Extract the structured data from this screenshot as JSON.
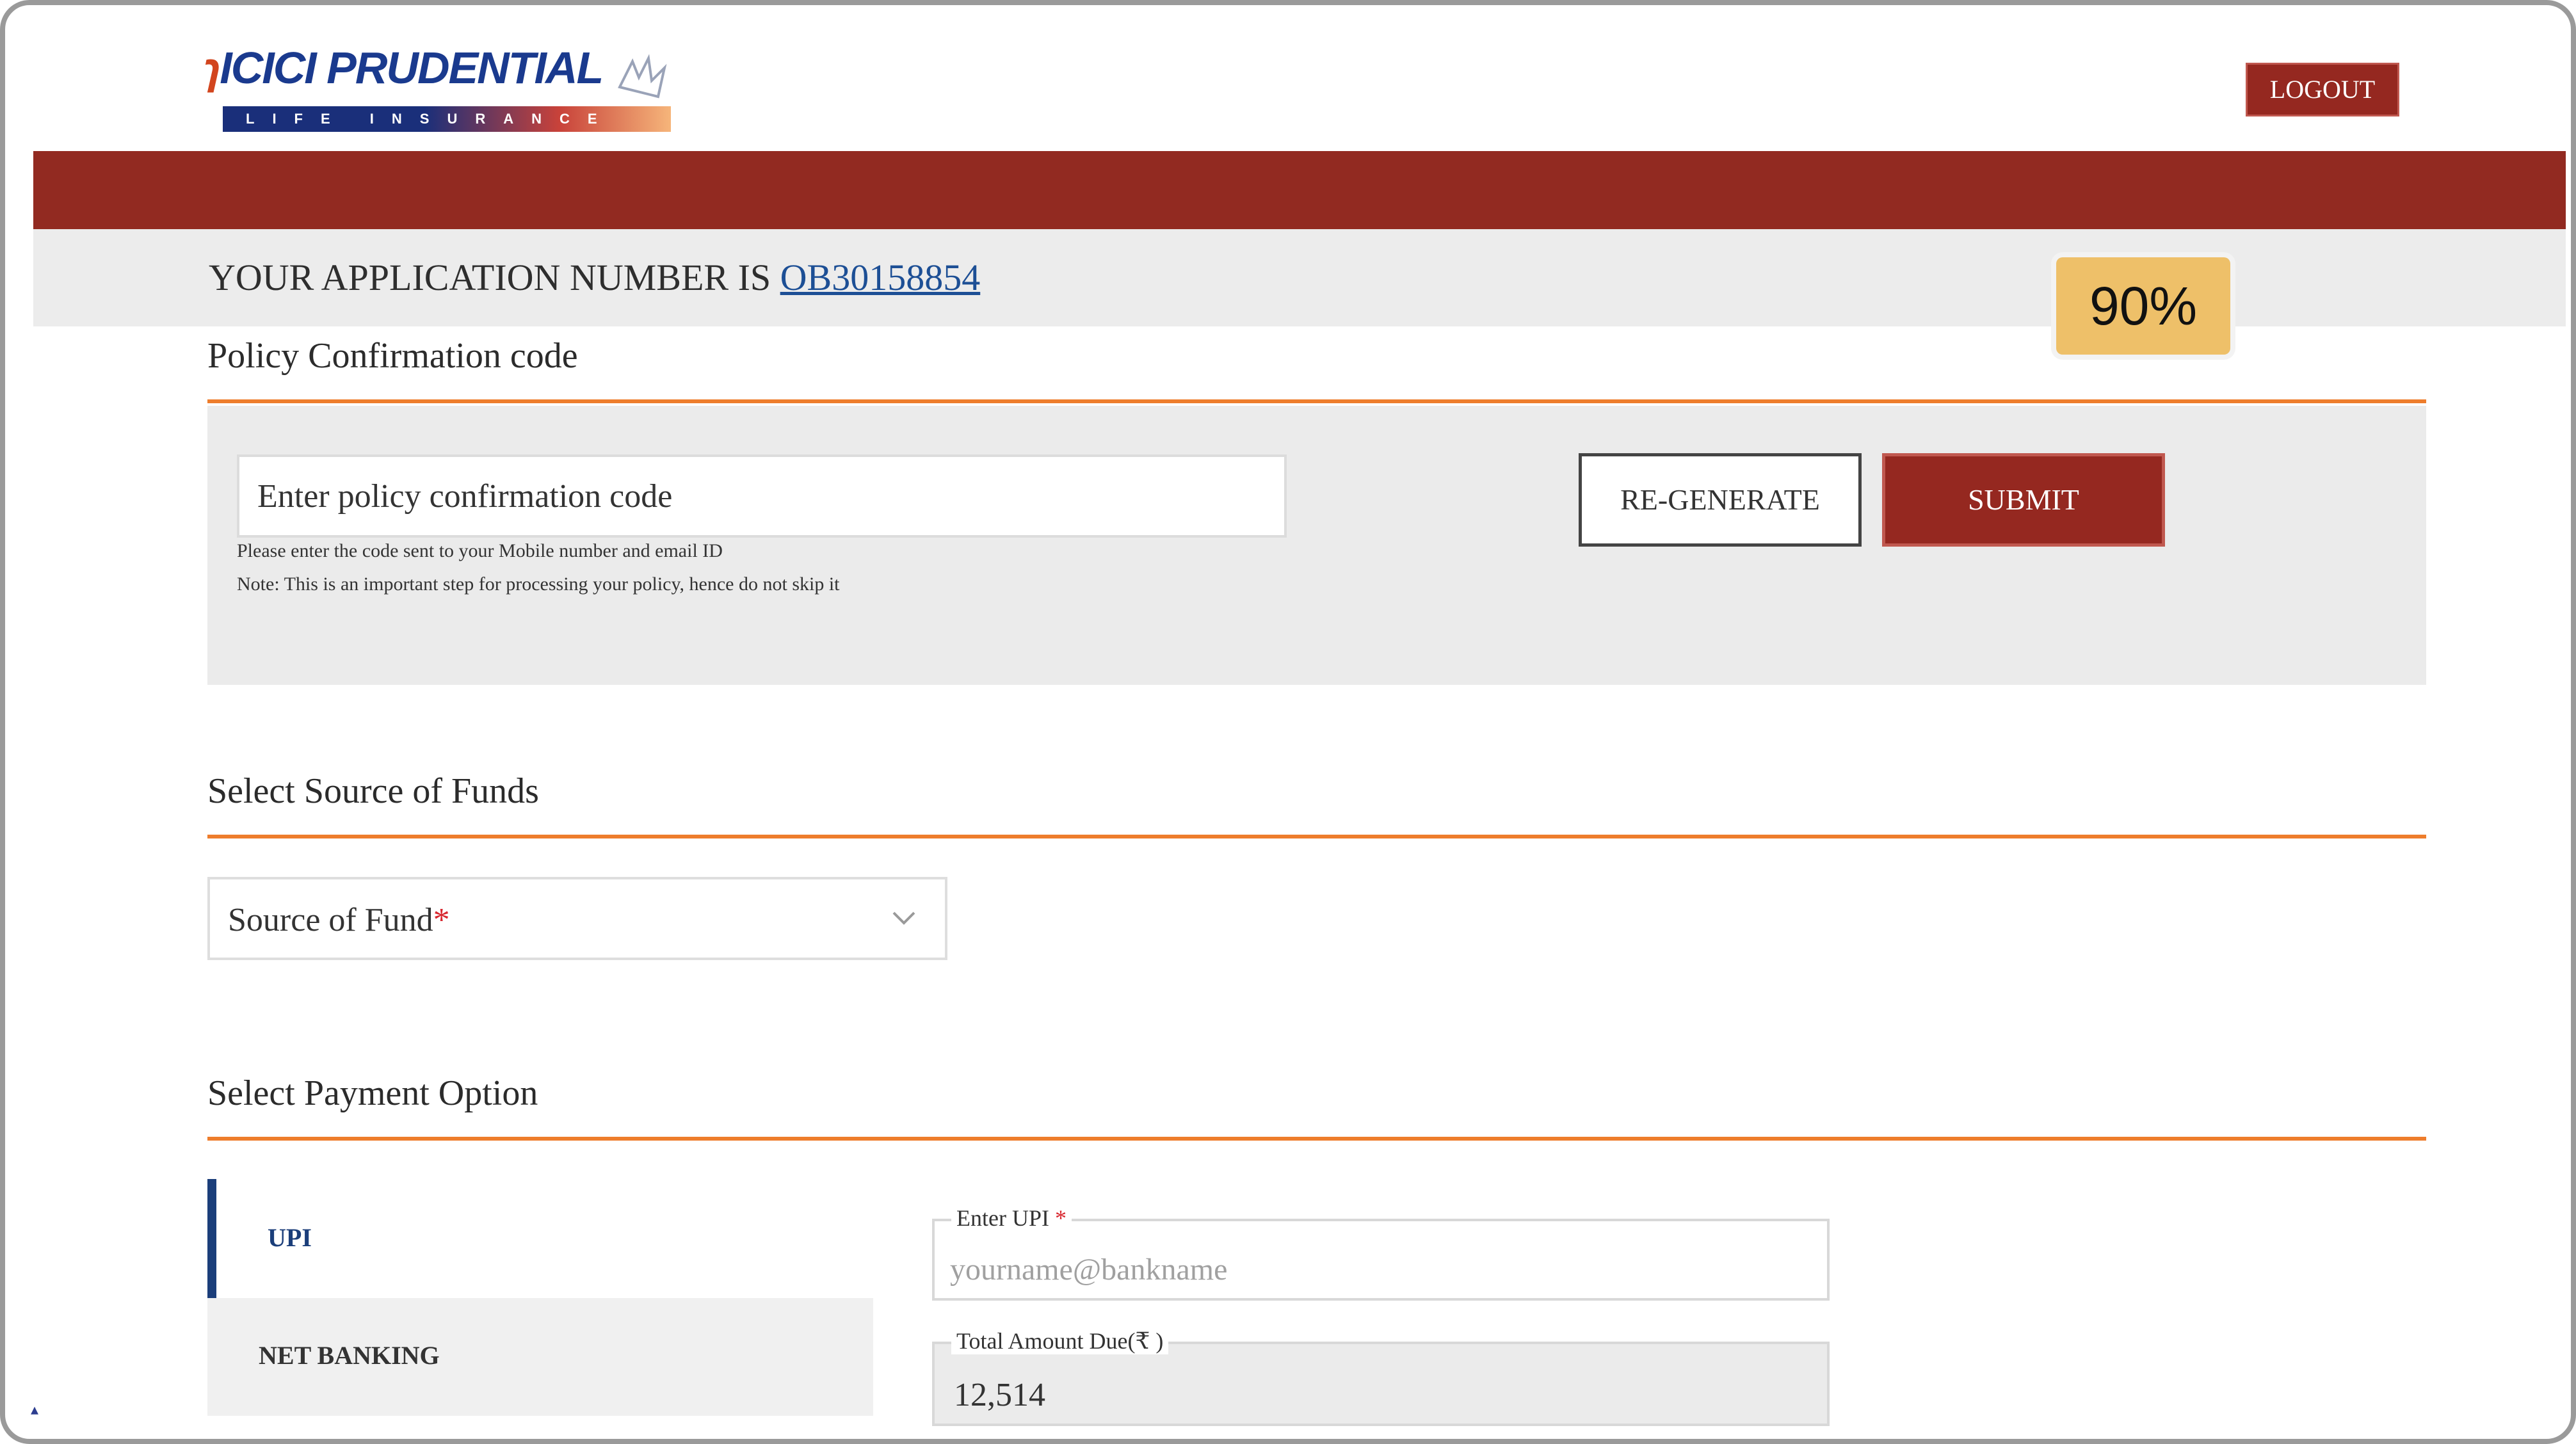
{
  "header": {
    "logo": {
      "brand": "ICICI PRUDENTIAL",
      "tagline": "LIFE INSURANCE"
    },
    "logout_label": "LOGOUT"
  },
  "application": {
    "prefix": "YOUR APPLICATION NUMBER IS",
    "number": "OB30158854",
    "progress": "90%",
    "progress_value": 0.9
  },
  "confirmation": {
    "title": "Policy Confirmation code",
    "input_placeholder": "Enter policy confirmation code",
    "hint_line1": "Please enter the code sent to your Mobile number and email ID",
    "hint_line2": "Note: This is an important step for processing your policy, hence do not skip it",
    "regenerate_label": "RE-GENERATE",
    "submit_label": "SUBMIT"
  },
  "funds": {
    "title": "Select Source of Funds",
    "select_label": "Source of Fund",
    "required_mark": "*"
  },
  "payment": {
    "title": "Select Payment Option",
    "tabs": [
      {
        "label": "UPI",
        "active": true
      },
      {
        "label": "NET BANKING",
        "active": false
      }
    ],
    "upi_label": "Enter UPI",
    "upi_required": "*",
    "upi_placeholder": "yourname@bankname",
    "amount_label": "Total Amount Due(₹ )",
    "amount_value": "12,514"
  },
  "colors": {
    "brand_red": "#922a21",
    "accent_orange": "#ee7d2c",
    "badge_gold": "#eec069",
    "link_blue": "#1d4f95"
  }
}
